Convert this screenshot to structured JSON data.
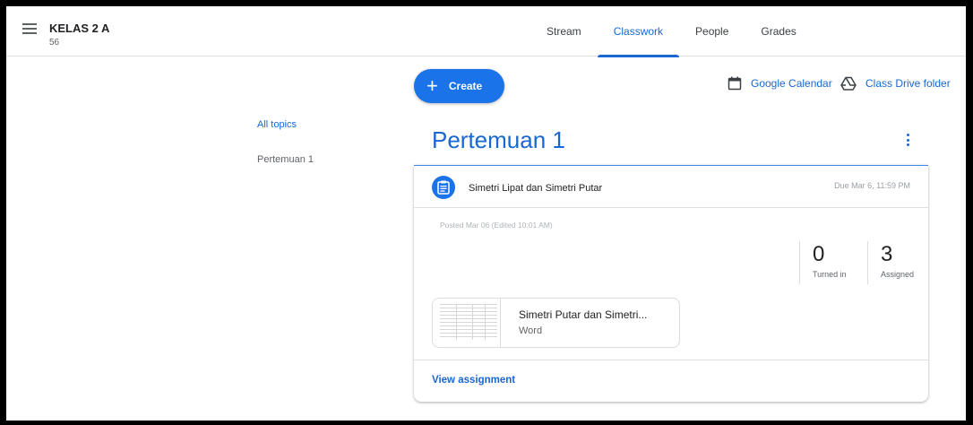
{
  "header": {
    "class_title": "KELAS 2 A",
    "class_section": "56",
    "tabs": [
      {
        "label": "Stream",
        "active": false
      },
      {
        "label": "Classwork",
        "active": true
      },
      {
        "label": "People",
        "active": false
      },
      {
        "label": "Grades",
        "active": false
      }
    ]
  },
  "toolbar": {
    "create_label": "Create",
    "calendar_label": "Google Calendar",
    "drive_label": "Class Drive folder"
  },
  "topics": {
    "all_label": "All topics",
    "items": [
      "Pertemuan 1"
    ]
  },
  "topic_section": {
    "title": "Pertemuan 1",
    "assignment": {
      "title": "Simetri Lipat dan Simetri Putar",
      "due": "Due Mar 6, 11:59 PM",
      "posted": "Posted Mar 06 (Edited 10:01 AM)",
      "turned_in_count": "0",
      "turned_in_label": "Turned in",
      "assigned_count": "3",
      "assigned_label": "Assigned",
      "attachment": {
        "title": "Simetri Putar dan Simetri...",
        "type": "Word"
      },
      "view_label": "View assignment"
    }
  },
  "colors": {
    "accent": "#1967d2",
    "button": "#1a73e8"
  }
}
